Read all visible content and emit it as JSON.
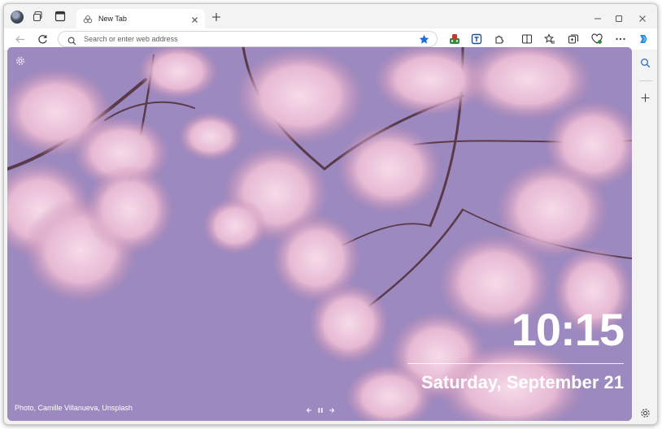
{
  "tabs": [
    {
      "title": "New Tab",
      "favicon": "edge-newtab-icon"
    }
  ],
  "address_bar": {
    "placeholder": "Search or enter web address",
    "icon": "search-icon"
  },
  "new_tab_page": {
    "clock_time": "10:15",
    "date": "Saturday, September 21",
    "photo_credit": "Photo, Camille Villanueva, Unsplash"
  },
  "colors": {
    "sky": "#9b89bf",
    "blossom": "#e9bfd8",
    "blossom_dark": "#c889b0",
    "branch": "#5a3a4a",
    "favorite_star": "#1a6fd6"
  },
  "icons": {
    "sidebar": [
      "search-icon",
      "add-icon",
      "settings-icon"
    ],
    "toolbar": [
      "extension-game-icon",
      "extension-tab-icon",
      "extensions-icon",
      "split-screen-icon",
      "favorites-icon",
      "collections-icon",
      "browser-essentials-icon",
      "more-icon",
      "copilot-icon"
    ]
  }
}
